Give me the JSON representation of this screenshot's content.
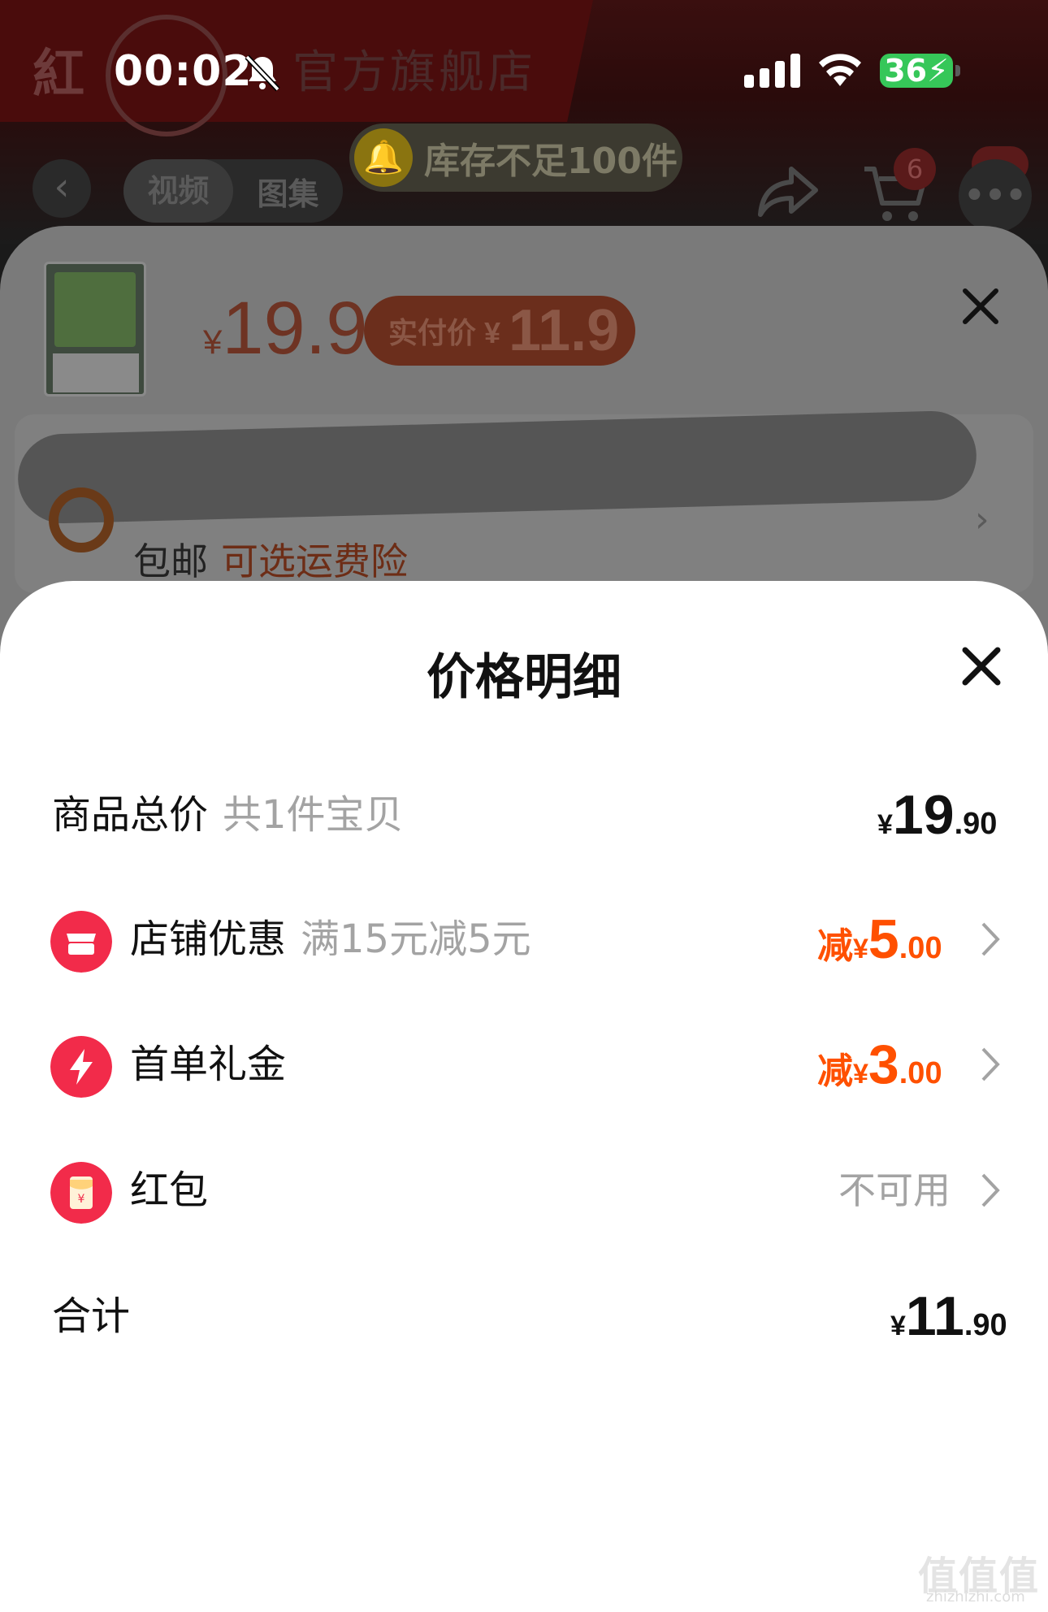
{
  "status_bar": {
    "time": "00:02",
    "battery": "36"
  },
  "background": {
    "store_logo": "紅",
    "store_name": "官方旗舰店",
    "nav": {
      "back_icon": "chevron-left-icon",
      "tabs": [
        "视频",
        "图集"
      ],
      "stock_notice": "库存不足100件",
      "cart_count": "6"
    },
    "sku": {
      "currency": "¥",
      "price": "19.9",
      "pay_label": "实付价 ¥",
      "pay_price": "11.9",
      "shipping": "包邮",
      "shipping_option": "可选运费险"
    }
  },
  "price_detail": {
    "title": "价格明细",
    "rows": [
      {
        "label": "商品总价",
        "sub": "共1件宝贝",
        "currency": "¥",
        "int": "19",
        "dec": ".90"
      },
      {
        "label": "店铺优惠",
        "sub": "满15元减5元",
        "prefix": "减",
        "currency": "¥",
        "int": "5",
        "dec": ".00",
        "icon": "store-icon"
      },
      {
        "label": "首单礼金",
        "prefix": "减",
        "currency": "¥",
        "int": "3",
        "dec": ".00",
        "icon": "lightning-icon"
      },
      {
        "label": "红包",
        "status": "不可用",
        "icon": "red-envelope-icon"
      }
    ],
    "total": {
      "label": "合计",
      "currency": "¥",
      "int": "11",
      "dec": ".90"
    }
  },
  "watermark": {
    "text": "值值值",
    "url": "zhizhizhi.com"
  },
  "colors": {
    "accent_red": "#f22b4a",
    "discount_orange": "#ff5000",
    "sub_text": "#a3a3a3"
  }
}
